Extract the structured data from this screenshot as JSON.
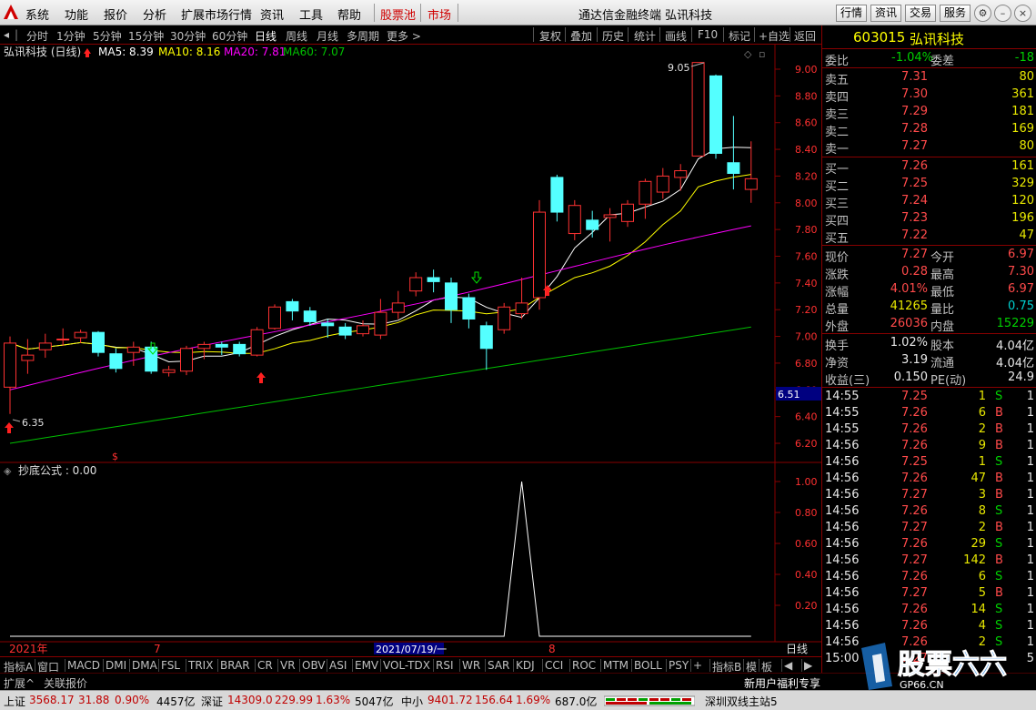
{
  "menu": {
    "items": [
      "系统",
      "功能",
      "报价",
      "分析",
      "扩展市场行情",
      "资讯",
      "工具",
      "帮助"
    ],
    "red_items": [
      "股票池",
      "市场"
    ],
    "window_title": "通达信金融终端 弘讯科技",
    "right_buttons": [
      "行情",
      "资讯",
      "交易",
      "服务"
    ]
  },
  "toolbar": {
    "periods": [
      "分时",
      "1分钟",
      "5分钟",
      "15分钟",
      "30分钟",
      "60分钟",
      "日线",
      "周线",
      "月线",
      "多周期",
      "更多 >"
    ],
    "active_period": "日线",
    "tools": [
      "复权",
      "叠加",
      "历史",
      "统计",
      "画线",
      "F10",
      "标记",
      "+自选",
      "返回"
    ]
  },
  "chart": {
    "title": "弘讯科技 (日线)",
    "ma_labels": [
      "MA5: 8.39",
      "MA10: 8.16",
      "MA20: 7.81",
      "MA60: 7.07"
    ],
    "ma_colors": [
      "#ffffff",
      "#ffff00",
      "#ff00ff",
      "#00c000"
    ],
    "high_label": "9.05",
    "low_label": "6.35",
    "current_price_tag": "6.51",
    "price_axis": [
      "9.00",
      "8.80",
      "8.60",
      "8.40",
      "8.20",
      "8.00",
      "7.80",
      "7.60",
      "7.40",
      "7.20",
      "7.00",
      "6.80",
      "6.60",
      "6.40",
      "6.20"
    ],
    "indicator_title": "抄底公式 : 0.00",
    "indicator_axis": [
      "1.00",
      "0.80",
      "0.60",
      "0.40",
      "0.20"
    ],
    "date_axis": [
      "2021年",
      "7",
      "2021/07/19/一",
      "8"
    ],
    "period_label": "日线",
    "candles": [
      [
        6.62,
        6.95,
        6.42,
        7.0
      ],
      [
        6.82,
        6.86,
        6.72,
        6.98
      ],
      [
        6.9,
        6.95,
        6.84,
        7.02
      ],
      [
        6.98,
        6.98,
        6.93,
        7.06
      ],
      [
        6.99,
        7.03,
        6.95,
        7.05
      ],
      [
        7.03,
        6.88,
        6.85,
        7.04
      ],
      [
        6.87,
        6.76,
        6.73,
        6.91
      ],
      [
        6.88,
        6.92,
        6.78,
        6.96
      ],
      [
        6.92,
        6.74,
        6.72,
        6.96
      ],
      [
        6.73,
        6.75,
        6.7,
        6.78
      ],
      [
        6.74,
        6.91,
        6.71,
        6.93
      ],
      [
        6.91,
        6.94,
        6.83,
        6.96
      ],
      [
        6.94,
        6.92,
        6.86,
        6.96
      ],
      [
        6.94,
        6.87,
        6.85,
        6.96
      ],
      [
        6.86,
        7.05,
        6.85,
        7.07
      ],
      [
        7.06,
        7.22,
        7.05,
        7.24
      ],
      [
        7.26,
        7.19,
        7.12,
        7.28
      ],
      [
        7.19,
        7.11,
        7.08,
        7.22
      ],
      [
        7.1,
        7.08,
        6.99,
        7.13
      ],
      [
        7.07,
        7.01,
        6.98,
        7.1
      ],
      [
        7.02,
        7.08,
        7.0,
        7.12
      ],
      [
        7.01,
        7.18,
        6.98,
        7.28
      ],
      [
        7.18,
        7.25,
        7.13,
        7.34
      ],
      [
        7.34,
        7.44,
        7.3,
        7.48
      ],
      [
        7.44,
        7.41,
        7.33,
        7.5
      ],
      [
        7.4,
        7.2,
        7.1,
        7.44
      ],
      [
        7.29,
        7.13,
        7.06,
        7.32
      ],
      [
        7.08,
        6.91,
        6.75,
        7.11
      ],
      [
        7.05,
        7.22,
        7.02,
        7.25
      ],
      [
        7.17,
        7.25,
        7.13,
        7.44
      ],
      [
        7.29,
        7.93,
        7.2,
        8.02
      ],
      [
        8.19,
        7.93,
        7.86,
        8.21
      ],
      [
        7.77,
        7.98,
        7.72,
        8.02
      ],
      [
        7.87,
        7.8,
        7.74,
        7.94
      ],
      [
        7.89,
        7.91,
        7.71,
        7.96
      ],
      [
        7.86,
        7.99,
        7.82,
        8.02
      ],
      [
        7.99,
        8.16,
        7.88,
        8.18
      ],
      [
        8.08,
        8.2,
        8.03,
        8.26
      ],
      [
        8.19,
        8.24,
        8.09,
        8.29
      ],
      [
        8.35,
        9.05,
        8.35,
        9.05
      ],
      [
        8.95,
        8.37,
        8.33,
        8.96
      ],
      [
        8.3,
        8.22,
        8.1,
        8.65
      ],
      [
        8.1,
        8.18,
        8.0,
        8.46
      ]
    ]
  },
  "quote": {
    "code": "603015",
    "name": "弘讯科技",
    "webi_label": "委比",
    "webi_value": "-1.04%",
    "weicha_label": "委差",
    "weicha_value": "-18",
    "asks": [
      {
        "label": "卖五",
        "price": "7.31",
        "vol": "80"
      },
      {
        "label": "卖四",
        "price": "7.30",
        "vol": "361"
      },
      {
        "label": "卖三",
        "price": "7.29",
        "vol": "181"
      },
      {
        "label": "卖二",
        "price": "7.28",
        "vol": "169"
      },
      {
        "label": "卖一",
        "price": "7.27",
        "vol": "80"
      }
    ],
    "bids": [
      {
        "label": "买一",
        "price": "7.26",
        "vol": "161"
      },
      {
        "label": "买二",
        "price": "7.25",
        "vol": "329"
      },
      {
        "label": "买三",
        "price": "7.24",
        "vol": "120"
      },
      {
        "label": "买四",
        "price": "7.23",
        "vol": "196"
      },
      {
        "label": "买五",
        "price": "7.22",
        "vol": "47"
      }
    ],
    "stats": [
      {
        "l1": "现价",
        "v1": "7.27",
        "l2": "今开",
        "v2": "6.97"
      },
      {
        "l1": "涨跌",
        "v1": "0.28",
        "l2": "最高",
        "v2": "7.30"
      },
      {
        "l1": "涨幅",
        "v1": "4.01%",
        "l2": "最低",
        "v2": "6.97"
      },
      {
        "l1": "总量",
        "v1": "41265",
        "l2": "量比",
        "v2": "0.75"
      },
      {
        "l1": "外盘",
        "v1": "26036",
        "l2": "内盘",
        "v2": "15229"
      }
    ],
    "stats2": [
      {
        "l1": "换手",
        "v1": "1.02%",
        "l2": "股本",
        "v2": "4.04亿"
      },
      {
        "l1": "净资",
        "v1": "3.19",
        "l2": "流通",
        "v2": "4.04亿"
      },
      {
        "l1": "收益(三)",
        "v1": "0.150",
        "l2": "PE(动)",
        "v2": "24.9"
      }
    ],
    "ticks": [
      {
        "t": "14:55",
        "p": "7.25",
        "v": "1",
        "s": "S",
        "n": "1"
      },
      {
        "t": "14:55",
        "p": "7.26",
        "v": "6",
        "s": "B",
        "n": "1"
      },
      {
        "t": "14:55",
        "p": "7.26",
        "v": "2",
        "s": "B",
        "n": "1"
      },
      {
        "t": "14:56",
        "p": "7.26",
        "v": "9",
        "s": "B",
        "n": "1"
      },
      {
        "t": "14:56",
        "p": "7.25",
        "v": "1",
        "s": "S",
        "n": "1"
      },
      {
        "t": "14:56",
        "p": "7.26",
        "v": "47",
        "s": "B",
        "n": "1"
      },
      {
        "t": "14:56",
        "p": "7.27",
        "v": "3",
        "s": "B",
        "n": "1"
      },
      {
        "t": "14:56",
        "p": "7.26",
        "v": "8",
        "s": "S",
        "n": "1"
      },
      {
        "t": "14:56",
        "p": "7.27",
        "v": "2",
        "s": "B",
        "n": "1"
      },
      {
        "t": "14:56",
        "p": "7.26",
        "v": "29",
        "s": "S",
        "n": "1"
      },
      {
        "t": "14:56",
        "p": "7.27",
        "v": "142",
        "s": "B",
        "n": "1"
      },
      {
        "t": "14:56",
        "p": "7.26",
        "v": "6",
        "s": "S",
        "n": "1"
      },
      {
        "t": "14:56",
        "p": "7.27",
        "v": "5",
        "s": "B",
        "n": "1"
      },
      {
        "t": "14:56",
        "p": "7.26",
        "v": "14",
        "s": "S",
        "n": "1"
      },
      {
        "t": "14:56",
        "p": "7.26",
        "v": "4",
        "s": "S",
        "n": "1"
      },
      {
        "t": "14:56",
        "p": "7.26",
        "v": "2",
        "s": "S",
        "n": "1"
      },
      {
        "t": "15:00",
        "p": "7.27",
        "v": "",
        "s": "",
        "n": "5"
      }
    ]
  },
  "bottom_tabs": [
    "指标A",
    "窗口",
    "MACD",
    "DMI",
    "DMA",
    "FSL",
    "TRIX",
    "BRAR",
    "CR",
    "VR",
    "OBV",
    "ASI",
    "EMV",
    "VOL-TDX",
    "RSI",
    "WR",
    "SAR",
    "KDJ",
    "CCI",
    "ROC",
    "MTM",
    "BOLL",
    "PSY",
    "+",
    "指标B",
    "模",
    "板",
    "◀",
    "▶"
  ],
  "bottom_row2": [
    "扩展^",
    "关联报价"
  ],
  "bottom_promo": "新用户福利专享",
  "status": {
    "sh_label": "上证",
    "sh_value": "3568.17",
    "sh_change": "31.88",
    "sh_pct": "0.90%",
    "sh_amount": "4457亿",
    "sz_label": "深证",
    "sz_value": "14309.0",
    "sz_change": "229.99",
    "sz_pct": "1.63%",
    "sz_amount": "5047亿",
    "zx_label": "中小",
    "zx_value": "9401.72",
    "zx_change": "156.64",
    "zx_pct": "1.69%",
    "zx_amount": "687.0亿",
    "server": "深圳双线主站5"
  },
  "watermark": {
    "text": "股票六六",
    "sub": "GP66.CN"
  }
}
